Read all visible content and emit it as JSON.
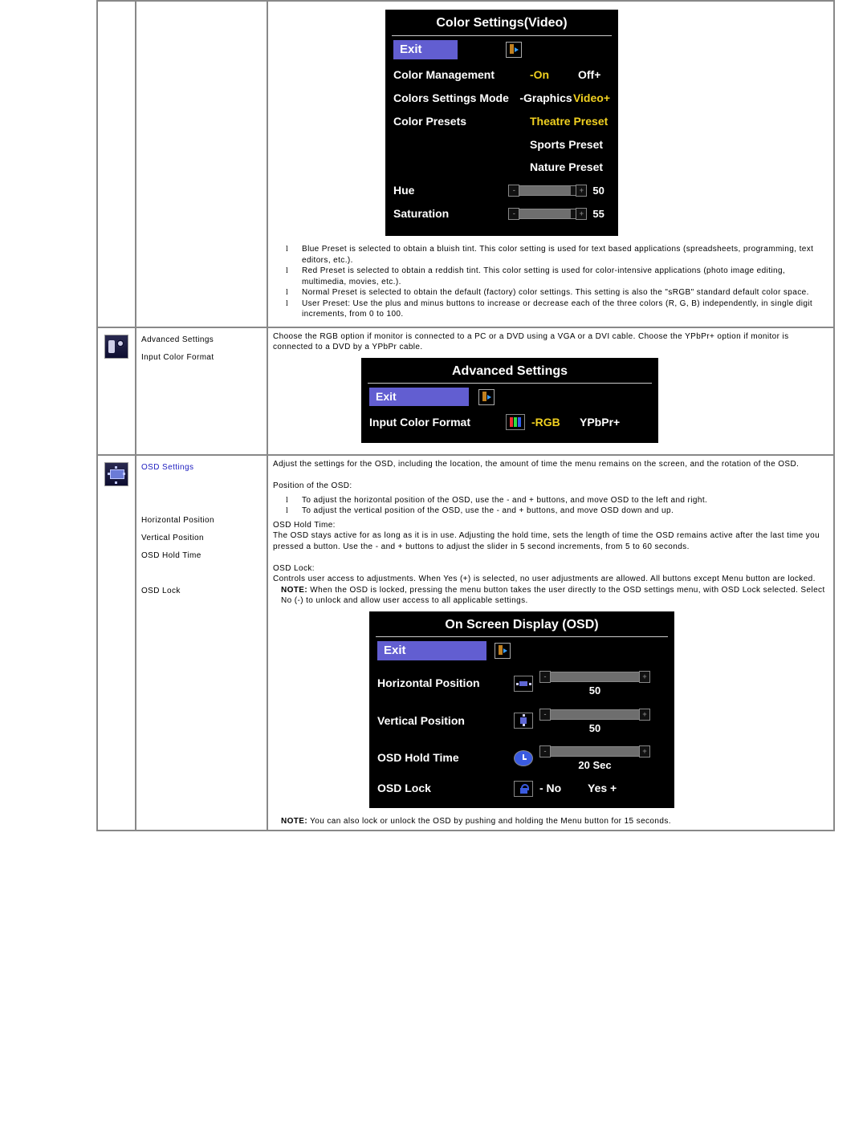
{
  "row1": {
    "osd": {
      "title": "Color Settings(Video)",
      "exit": "Exit",
      "mgmt_label": "Color Management",
      "mgmt_on": "-On",
      "mgmt_off": "Off+",
      "mode_label": "Colors Settings Mode",
      "mode_g": "-Graphics",
      "mode_v": "Video+",
      "presets_label": "Color Presets",
      "preset1": "Theatre Preset",
      "preset2": "Sports Preset",
      "preset3": "Nature Preset",
      "hue_label": "Hue",
      "hue_val": "50",
      "sat_label": "Saturation",
      "sat_val": "55"
    },
    "bullets": {
      "b1": "Blue Preset is selected to obtain a bluish tint. This color setting is used for text based applications (spreadsheets, programming, text editors, etc.).",
      "b2": "Red Preset is selected to obtain a reddish tint. This color setting is used for color-intensive applications (photo image editing, multimedia, movies, etc.).",
      "b3": "Normal Preset is selected to obtain the default (factory) color settings. This setting is also the \"sRGB\" standard default color space.",
      "b4": "User Preset: Use the plus and minus buttons to increase or decrease each of the three colors (R, G, B) independently, in single digit increments, from 0 to 100."
    }
  },
  "row2": {
    "label1": "Advanced Settings",
    "label2": "Input Color Format",
    "desc": "Choose the RGB option if monitor is connected to a PC or a DVD using a VGA or a DVI cable. Choose the YPbPr+ option if monitor is connected to a DVD by a YPbPr cable.",
    "osd": {
      "title": "Advanced Settings",
      "exit": "Exit",
      "icf_label": "Input Color Format",
      "icf_rgb": "-RGB",
      "icf_ypbpr": "YPbPr+"
    }
  },
  "row3": {
    "label_title": "OSD Settings",
    "label_h": "Horizontal Position",
    "label_v": "Vertical Position",
    "label_hold": "OSD Hold Time",
    "label_lock": "OSD Lock",
    "p1": "Adjust the settings for the OSD, including the location, the amount of time the menu remains on the screen, and the rotation of the OSD.",
    "p2": "Position of the OSD:",
    "b1": "To adjust the horizontal position of the OSD, use the - and + buttons, and move OSD to the left and right.",
    "b2": "To adjust the vertical position of the OSD, use the - and + buttons, and move OSD down and up.",
    "hold_h": "OSD Hold Time:",
    "hold_p": "The OSD stays active for as long as it is in use. Adjusting the hold time, sets the length of time the OSD remains active after the last time you pressed a button. Use the - and + buttons to adjust the slider in 5 second increments, from 5 to 60 seconds.",
    "lock_h": "OSD Lock:",
    "lock_p": "Controls user access to adjustments. When Yes (+) is selected, no user adjustments are allowed. All buttons except Menu button are locked.",
    "note1a": "NOTE:",
    "note1b": " When the OSD is locked, pressing the menu button takes the user directly to the OSD settings menu, with OSD Lock selected. Select No (-) to unlock and allow user access to all applicable settings.",
    "osd": {
      "title": "On Screen Display (OSD)",
      "exit": "Exit",
      "h_label": "Horizontal Position",
      "h_val": "50",
      "v_label": "Vertical Position",
      "v_val": "50",
      "hold_label": "OSD Hold Time",
      "hold_val": "20 Sec",
      "lock_label": "OSD Lock",
      "lock_no": "-  No",
      "lock_yes": "Yes +"
    },
    "note2a": "NOTE:",
    "note2b": " You can also lock or unlock the OSD by pushing and holding the Menu button for 15 seconds."
  }
}
